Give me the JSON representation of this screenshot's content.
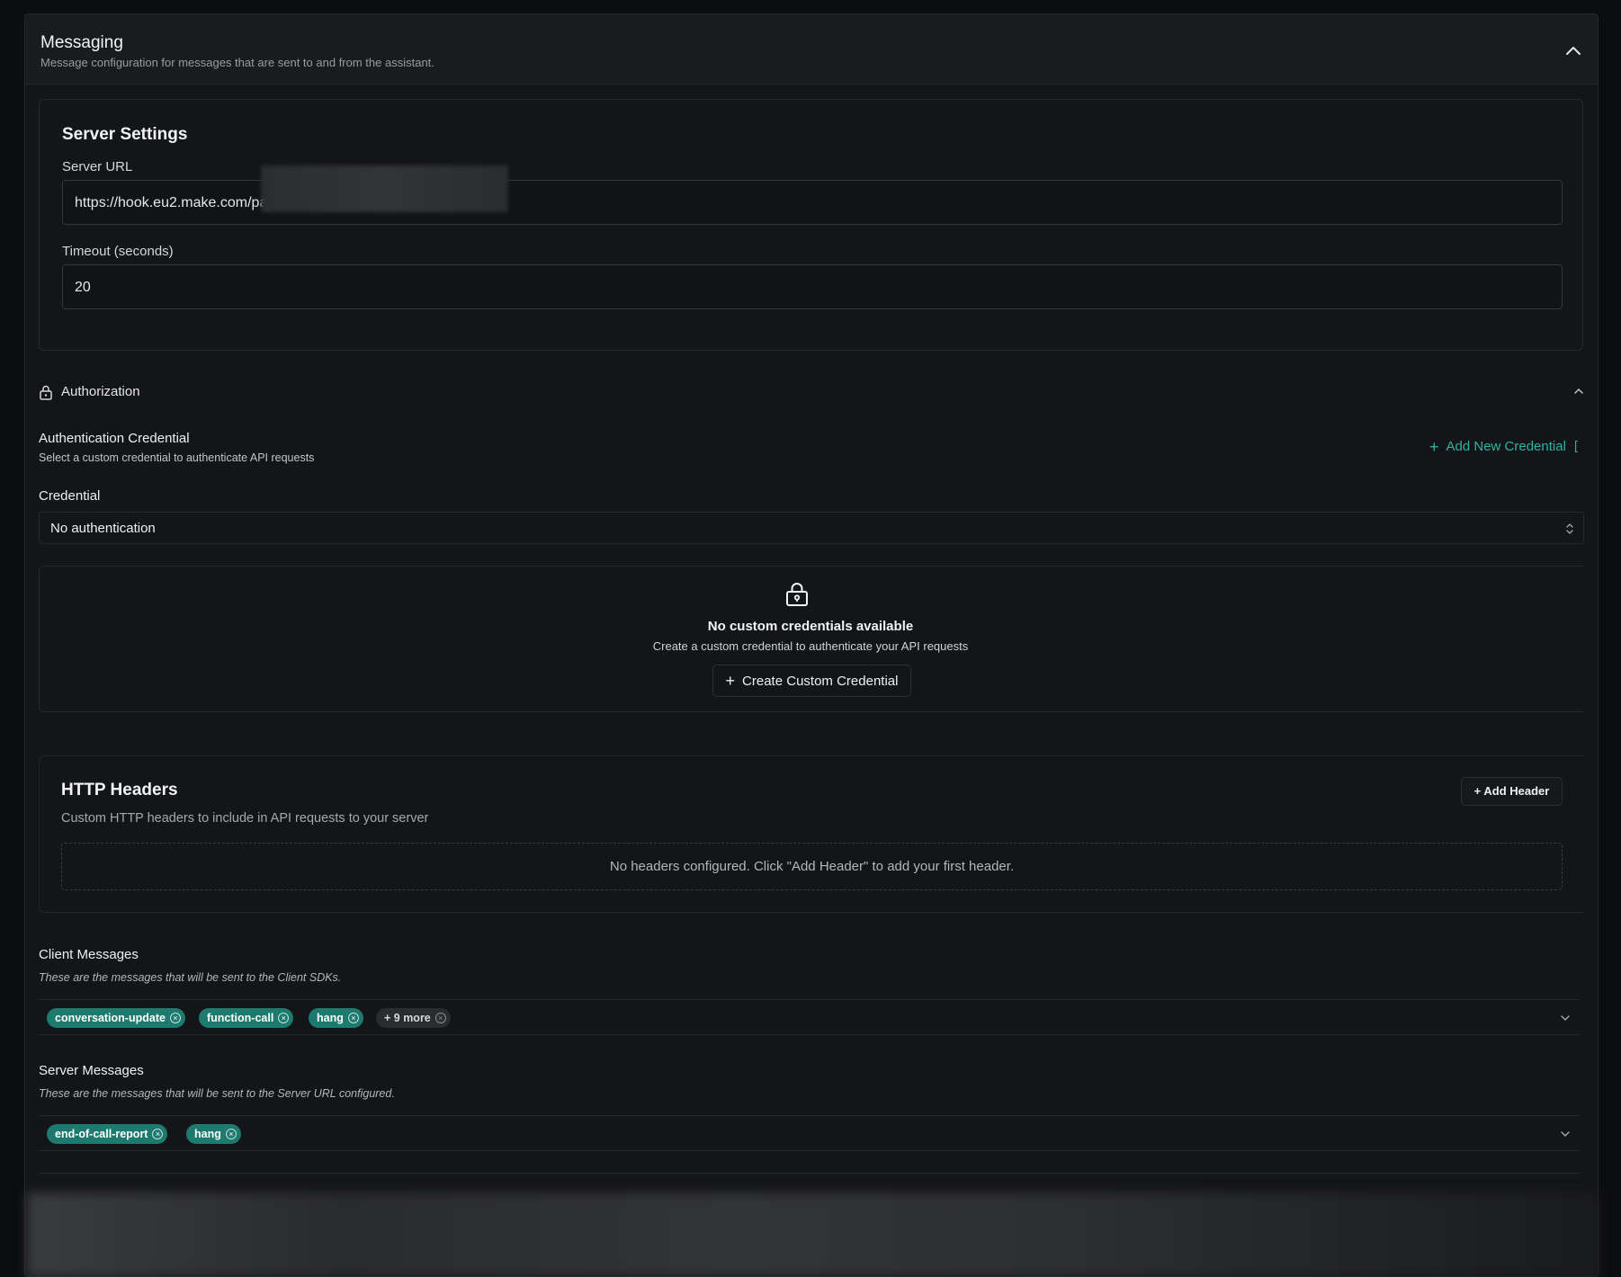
{
  "messaging": {
    "title": "Messaging",
    "subtitle": "Message configuration for messages that are sent to and from the assistant."
  },
  "server_settings": {
    "title": "Server Settings",
    "url_label": "Server URL",
    "url_value": "https://hook.eu2.make.com/paj4v",
    "timeout_label": "Timeout (seconds)",
    "timeout_value": "20"
  },
  "authorization": {
    "title": "Authorization",
    "credential_heading": "Authentication Credential",
    "credential_description": "Select a custom credential to authenticate API requests",
    "add_new_label": "Add New Credential",
    "add_new_trailing": "[",
    "credential_label": "Credential",
    "credential_selected": "No authentication",
    "empty_title": "No custom credentials available",
    "empty_description": "Create a custom credential to authenticate your API requests",
    "create_button_label": "Create Custom Credential"
  },
  "http_headers": {
    "title": "HTTP Headers",
    "description": "Custom HTTP headers to include in API requests to your server",
    "add_button_label": "Add Header",
    "empty_text": "No headers configured. Click \"Add Header\" to add your first header."
  },
  "client_messages": {
    "title": "Client Messages",
    "description": "These are the messages that will be sent to the Client SDKs.",
    "tags": [
      "conversation-update",
      "function-call",
      "hang"
    ],
    "more_label": "+ 9 more"
  },
  "server_messages": {
    "title": "Server Messages",
    "description": "These are the messages that will be sent to the Server URL configured.",
    "tags": [
      "end-of-call-report",
      "hang"
    ]
  },
  "colors": {
    "accent": "#2fb3a1",
    "tag_bg": "#1d7a6f",
    "panel_bg": "#141518",
    "page_bg": "#0c0d0f"
  }
}
